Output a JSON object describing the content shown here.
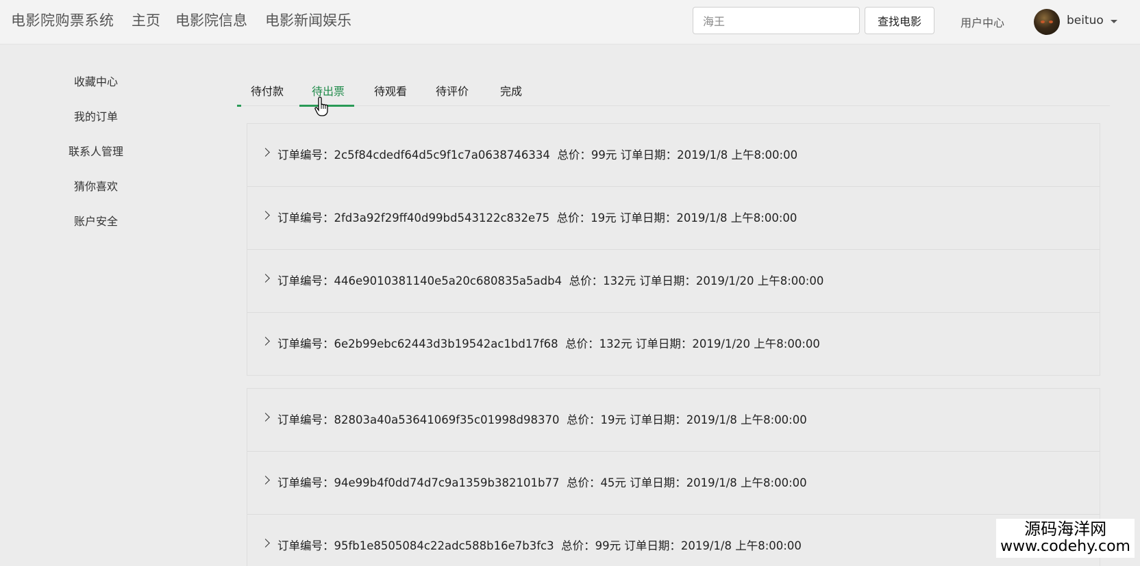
{
  "navbar": {
    "brand": "电影院购票系统",
    "links": [
      "主页",
      "电影院信息",
      "电影新闻娱乐"
    ],
    "search_value": "海王",
    "search_button": "查找电影",
    "user_center": "用户中心",
    "username": "beituo"
  },
  "sidebar": {
    "items": [
      "收藏中心",
      "我的订单",
      "联系人管理",
      "猜你喜欢",
      "账户安全"
    ]
  },
  "tabs": {
    "items": [
      "待付款",
      "待出票",
      "待观看",
      "待评价",
      "完成"
    ],
    "active": "待出票"
  },
  "orders": {
    "group1": [
      {
        "label": "订单编号：",
        "id": "2c5f84cdedf64d5c9f1c7a0638746334",
        "price_label": "总价：",
        "price": "99元",
        "date_label": "订单日期：",
        "date": "2019/1/8 上午8:00:00"
      },
      {
        "label": "订单编号：",
        "id": "2fd3a92f29ff40d99bd543122c832e75",
        "price_label": "总价：",
        "price": "19元",
        "date_label": "订单日期：",
        "date": "2019/1/8 上午8:00:00"
      },
      {
        "label": "订单编号：",
        "id": "446e9010381140e5a20c680835a5adb4",
        "price_label": "总价：",
        "price": "132元",
        "date_label": "订单日期：",
        "date": "2019/1/20 上午8:00:00"
      },
      {
        "label": "订单编号：",
        "id": "6e2b99ebc62443d3b19542ac1bd17f68",
        "price_label": "总价：",
        "price": "132元",
        "date_label": "订单日期：",
        "date": "2019/1/20 上午8:00:00"
      }
    ],
    "group2": [
      {
        "label": "订单编号：",
        "id": "82803a40a53641069f35c01998d98370",
        "price_label": "总价：",
        "price": "19元",
        "date_label": "订单日期：",
        "date": "2019/1/8 上午8:00:00"
      },
      {
        "label": "订单编号：",
        "id": "94e99b4f0dd74d7c9a1359b382101b77",
        "price_label": "总价：",
        "price": "45元",
        "date_label": "订单日期：",
        "date": "2019/1/8 上午8:00:00"
      },
      {
        "label": "订单编号：",
        "id": "95fb1e8505084c22adc588b16e7b3fc3",
        "price_label": "总价：",
        "price": "99元",
        "date_label": "订单日期：",
        "date": "2019/1/8 上午8:00:00"
      }
    ]
  },
  "watermark": {
    "line1": "源码海洋网",
    "line2": "www.codehy.com"
  },
  "colors": {
    "accent": "#2a9a56",
    "background": "#ececec"
  }
}
